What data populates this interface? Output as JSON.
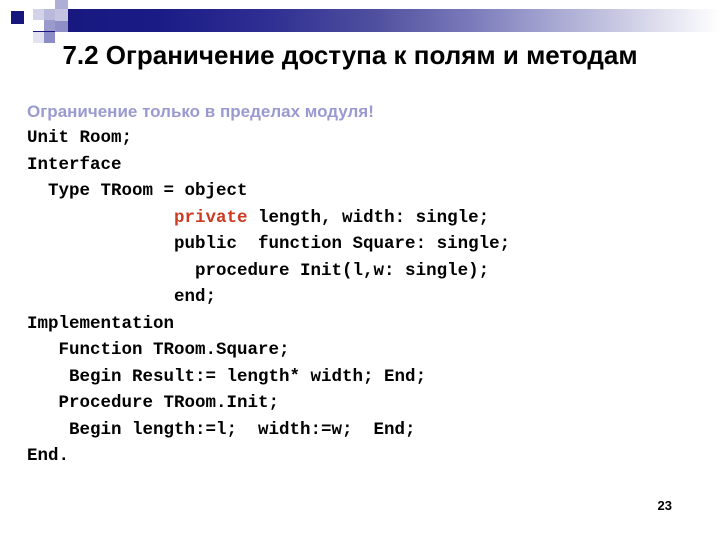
{
  "slide": {
    "title": "7.2 Ограничение доступа к полям и методам",
    "subtitle": "Ограничение только в пределах модуля!",
    "number": "23",
    "accent_color": "#16167c",
    "subtitle_color": "#9a9ad0",
    "keyword_color": "#cc3b22",
    "background_color": "#ffffff"
  },
  "deco": {
    "navy_square": "navy-square",
    "gradient_bar": "gradient-bar"
  },
  "code": {
    "line1": "Unit Room;",
    "line2": "Interface",
    "line3": "  Type TRoom = object",
    "line4_indent": "              ",
    "line4_keyword": "private",
    "line4_rest": " length, width: single;",
    "line5": "              public  function Square: single;",
    "line6": "                procedure Init(l,w: single);",
    "line7": "              end;",
    "line8": "Implementation",
    "line9": "   Function TRoom.Square;",
    "line10": "    Begin Result:= length* width; End;",
    "line11": "   Procedure TRoom.Init;",
    "line12": "    Begin length:=l;  width:=w;  End;",
    "line13": "End."
  }
}
